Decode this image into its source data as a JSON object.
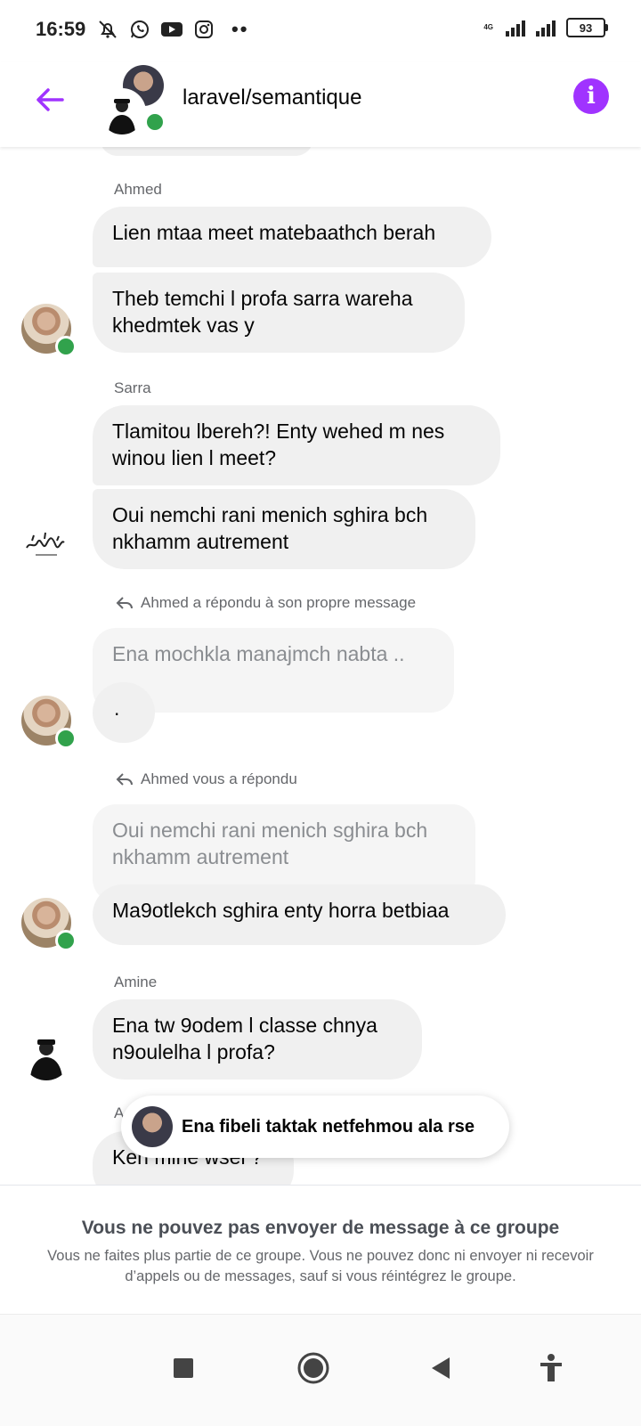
{
  "status_bar": {
    "time": "16:59",
    "icons": [
      "muted-bell-icon",
      "whatsapp-icon",
      "youtube-icon",
      "instagram-icon"
    ],
    "more": "••",
    "network": "4G",
    "battery": "93"
  },
  "header": {
    "title": "laravel/semantique",
    "back_icon": "back-arrow-icon",
    "info_icon": "info-icon",
    "accent_color": "#a033ff",
    "online_color": "#31a24c"
  },
  "messages": {
    "sender_ahmed": "Ahmed",
    "ahmed_msg1": "Lien mtaa meet matebaathch berah",
    "ahmed_msg2": "Theb temchi l profa sarra wareha\nkhedmtek vas y",
    "sender_sarra": "Sarra",
    "sarra_msg1": "Tlamitou lbereh?!  Enty wehed m nes\nwinou lien l meet?",
    "sarra_msg2": "Oui nemchi rani menich sghira bch\nnkhamm autrement",
    "reply_note1": "Ahmed a répondu à son propre message",
    "quote1": "Ena mochkla manajmch nabta ..",
    "ahmed_msg3": ".",
    "reply_note2": "Ahmed vous a répondu",
    "quote2": "Oui nemchi rani menich sghira bch\nnkhamm autrement",
    "ahmed_msg4": "Ma9otlekch sghira enty horra betbiaa",
    "sender_amine": "Amine",
    "amine_msg1": "Ena tw 9odem l classe chnya\nn9oulelha l profa?",
    "sender_partial": "A",
    "partial_msg": "Ken mine wsel ?"
  },
  "toast": {
    "text": "Ena fibeli taktak netfehmou ala rse"
  },
  "notice": {
    "title": "Vous ne pouvez pas envoyer de message à ce groupe",
    "body": "Vous ne faites plus partie de ce groupe. Vous ne pouvez donc ni envoyer ni recevoir d’appels ou de messages, sauf si vous réintégrez le groupe."
  },
  "navbar": {
    "icons": [
      "recents-square-icon",
      "home-circle-icon",
      "back-triangle-icon",
      "accessibility-icon"
    ]
  }
}
